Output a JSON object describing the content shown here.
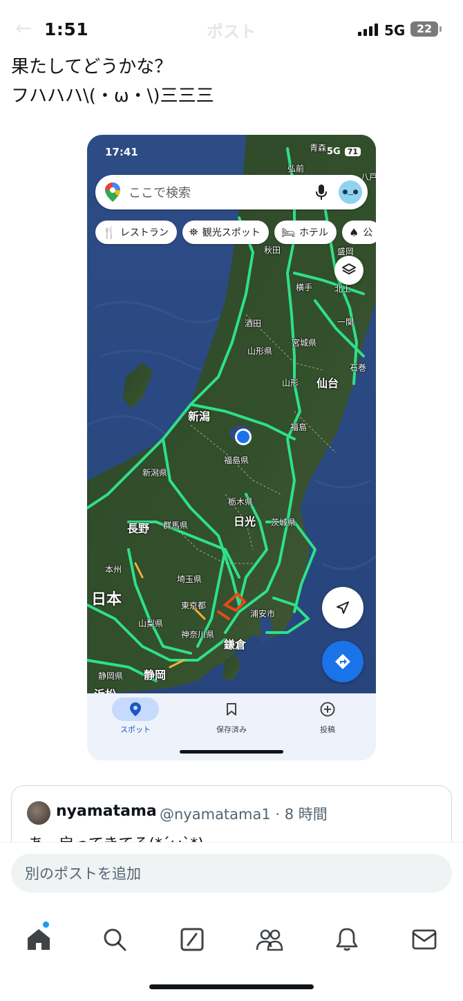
{
  "status_bar": {
    "time": "1:51",
    "network": "5G",
    "battery": "22",
    "header_title": "ポスト",
    "back_glyph": "←"
  },
  "post": {
    "line1": "果たしてどうかな？",
    "line2": "フハハハ\\(・ω・\\)三三三"
  },
  "embedded_screenshot": {
    "status": {
      "time": "17:41",
      "network": "5G",
      "battery": "71"
    },
    "search": {
      "placeholder": "ここで検索"
    },
    "chips": [
      {
        "label": "レストラン",
        "icon": "fork-knife-icon"
      },
      {
        "label": "観光スポット",
        "icon": "camera-spot-icon"
      },
      {
        "label": "ホテル",
        "icon": "bed-icon"
      },
      {
        "label": "公",
        "icon": "tree-icon"
      }
    ],
    "map_labels": {
      "aomori": "青森",
      "hirosaki": "弘前",
      "hachinohe": "八戸",
      "morioka": "盛岡",
      "akita": "秋田",
      "yokote": "横手",
      "kitakami": "北上",
      "ichinoseki": "一関",
      "sakata": "酒田",
      "miyagi_pref": "宮城県",
      "yamagata_pref": "山形県",
      "ishinomaki": "石巻",
      "yamagata": "山形",
      "sendai": "仙台",
      "niigata": "新潟",
      "fukushima": "福島",
      "fukushima_pref": "福島県",
      "niigata_pref": "新潟県",
      "tochigi_pref": "栃木県",
      "nikko": "日光",
      "nagano": "長野",
      "gunma_pref": "群馬県",
      "ibaraki_pref": "茨城県",
      "honshu": "本州",
      "saitama_pref": "埼玉県",
      "japan": "日本",
      "tokyo": "東京都",
      "urayasu": "浦安市",
      "yamanashi_pref": "山梨県",
      "kanagawa_pref": "神奈川県",
      "kamakura": "鎌倉",
      "shizuoka_pref": "静岡県",
      "shizuoka": "静岡",
      "hamamatsu": "浜松"
    },
    "bottom_tabs": [
      {
        "label": "スポット",
        "icon": "location-pin-icon"
      },
      {
        "label": "保存済み",
        "icon": "bookmark-icon"
      },
      {
        "label": "投稿",
        "icon": "plus-circle-icon"
      }
    ],
    "colors": {
      "accent": "#1a73e8",
      "road": "#2ee08a",
      "land": "#2f4a2a",
      "sea": "#2f4f8a"
    }
  },
  "quoted_post": {
    "name": "nyamatama",
    "handle_time": "@nyamatama1 · 8 時間",
    "text": "あ、戻ってきてる(*´ω`*)"
  },
  "reply": {
    "placeholder": "別のポストを追加"
  },
  "tab_bar": {
    "items": [
      {
        "name": "home",
        "icon": "home-icon",
        "has_notification_dot": true
      },
      {
        "name": "search",
        "icon": "search-icon"
      },
      {
        "name": "grok",
        "icon": "grok-icon"
      },
      {
        "name": "communities",
        "icon": "people-icon"
      },
      {
        "name": "notifications",
        "icon": "bell-icon"
      },
      {
        "name": "messages",
        "icon": "mail-icon"
      }
    ],
    "notification_dot_color": "#1d9bf0"
  }
}
